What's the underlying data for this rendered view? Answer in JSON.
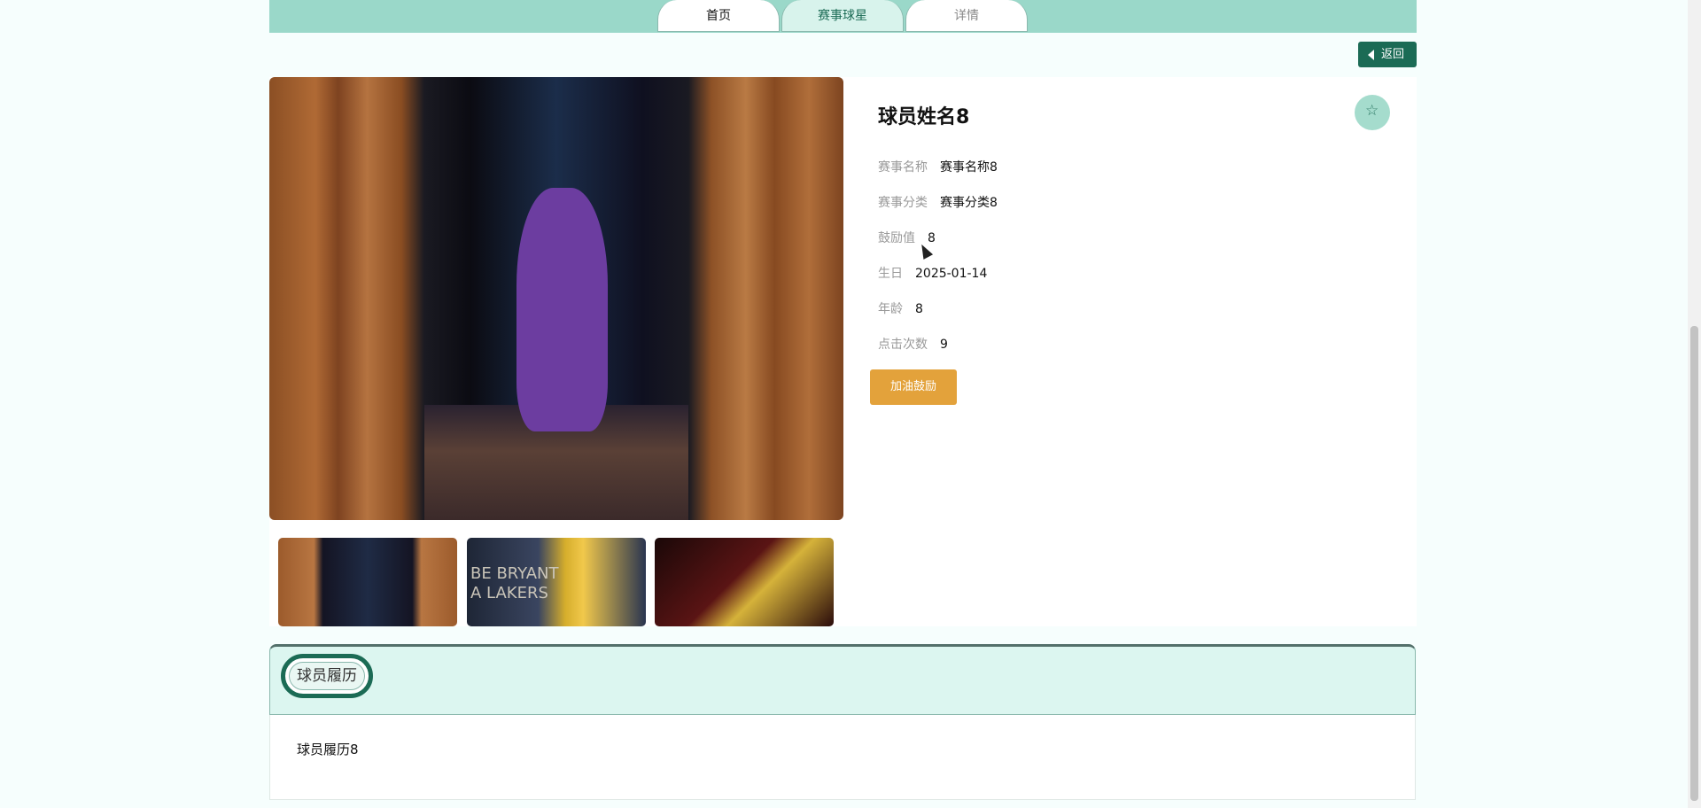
{
  "nav": {
    "tabs": [
      {
        "label": "首页"
      },
      {
        "label": "赛事球星"
      },
      {
        "label": "详情"
      }
    ]
  },
  "actions": {
    "back_label": "返回",
    "cheer_label": "加油鼓励"
  },
  "player": {
    "name": "球员姓名8",
    "fields": [
      {
        "key": "赛事名称",
        "value": "赛事名称8"
      },
      {
        "key": "赛事分类",
        "value": "赛事分类8"
      },
      {
        "key": "鼓励值",
        "value": "8"
      },
      {
        "key": "生日",
        "value": "2025-01-14"
      },
      {
        "key": "年龄",
        "value": "8"
      },
      {
        "key": "点击次数",
        "value": "9"
      }
    ]
  },
  "thumb2_text": [
    "BE BRYANT",
    "A LAKERS"
  ],
  "resume": {
    "heading": "球员履历",
    "content": "球员履历8"
  },
  "colors": {
    "primary": "#1b6b55",
    "accent": "#e3a23b",
    "nav_bg": "#9ad8c9"
  }
}
